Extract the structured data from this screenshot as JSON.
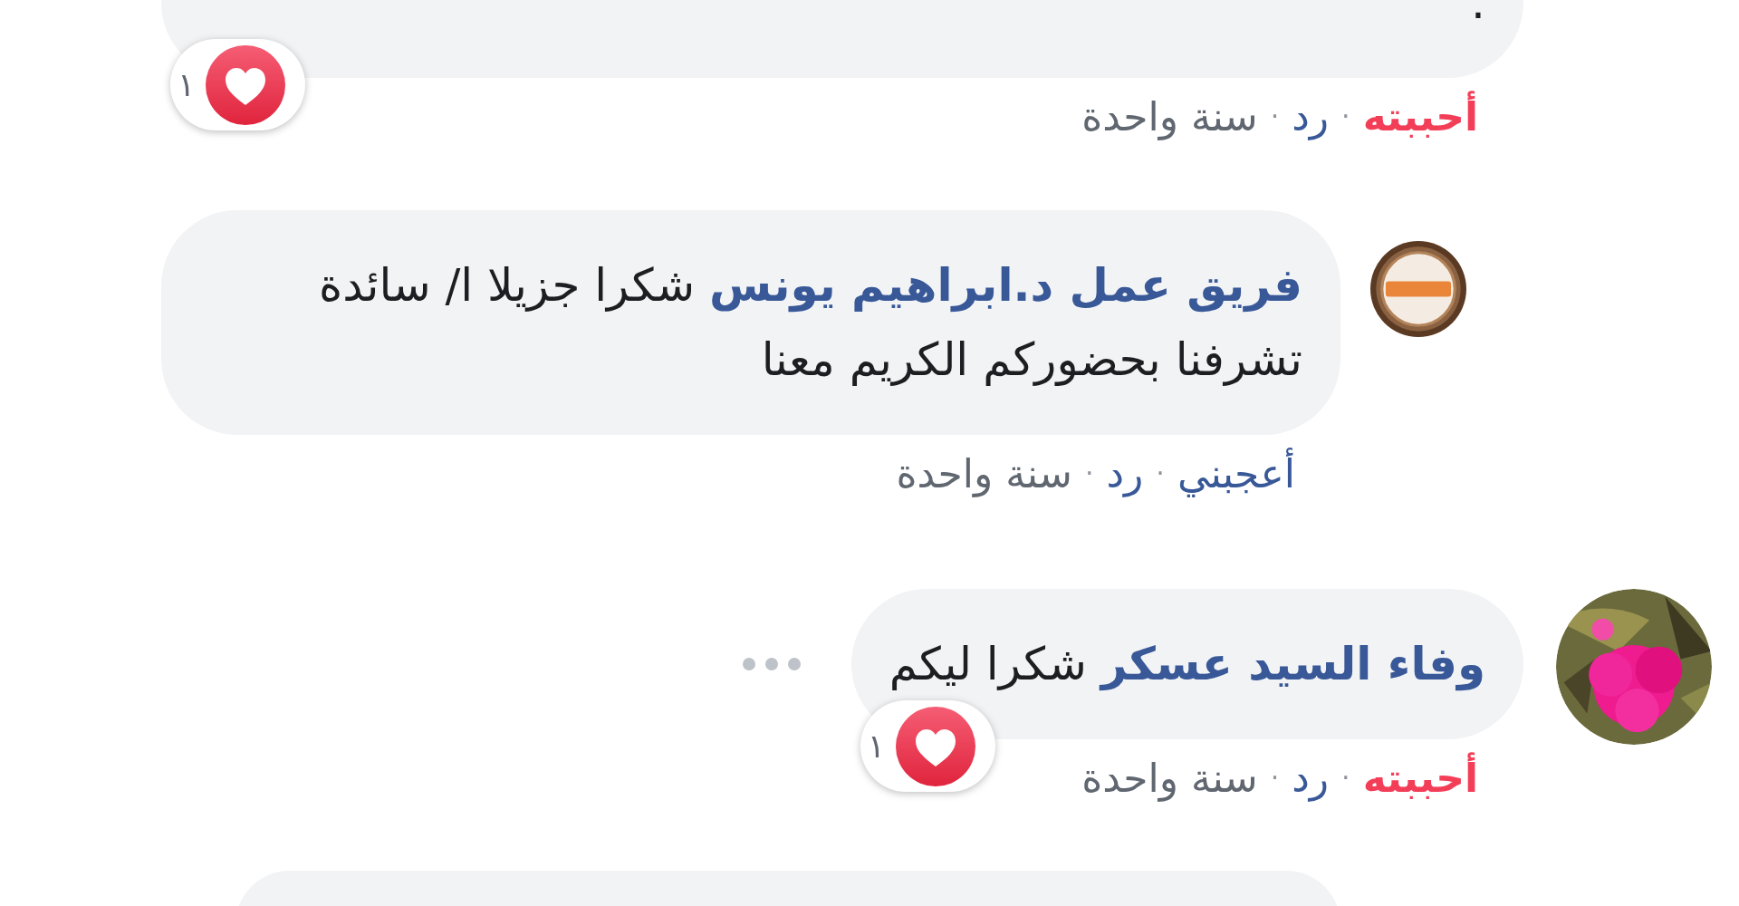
{
  "comments": [
    {
      "text": ".",
      "reaction": {
        "count": "١"
      },
      "actions": [
        {
          "kind": "like",
          "label": "أحببته",
          "liked": true
        },
        {
          "kind": "separator",
          "label": "·"
        },
        {
          "kind": "reply",
          "label": "رد"
        },
        {
          "kind": "separator",
          "label": "·"
        },
        {
          "kind": "time",
          "label": "سنة واحدة"
        }
      ],
      "replies": [
        {
          "avatar": {
            "kind": "logo"
          },
          "author": "فريق عمل د.ابراهيم يونس",
          "text": "شكرا جزيلا ا/ سائدة تشرفنا بحضوركم الكريم معنا",
          "actions": [
            {
              "kind": "like",
              "label": "أعجبني",
              "liked": false
            },
            {
              "kind": "separator",
              "label": "·"
            },
            {
              "kind": "reply",
              "label": "رد"
            },
            {
              "kind": "separator",
              "label": "·"
            },
            {
              "kind": "time",
              "label": "سنة واحدة"
            }
          ]
        }
      ]
    },
    {
      "avatar": {
        "kind": "picture"
      },
      "author": "وفاء السيد عسكر",
      "text": "شكرا ليكم",
      "more_button": true,
      "reaction": {
        "count": "١"
      },
      "actions": [
        {
          "kind": "like",
          "label": "أحببته",
          "liked": true
        },
        {
          "kind": "separator",
          "label": "·"
        },
        {
          "kind": "reply",
          "label": "رد"
        },
        {
          "kind": "separator",
          "label": "·"
        },
        {
          "kind": "time",
          "label": "سنة واحدة"
        }
      ],
      "replies": [
        {
          "kind": "cut_off"
        }
      ]
    }
  ]
}
